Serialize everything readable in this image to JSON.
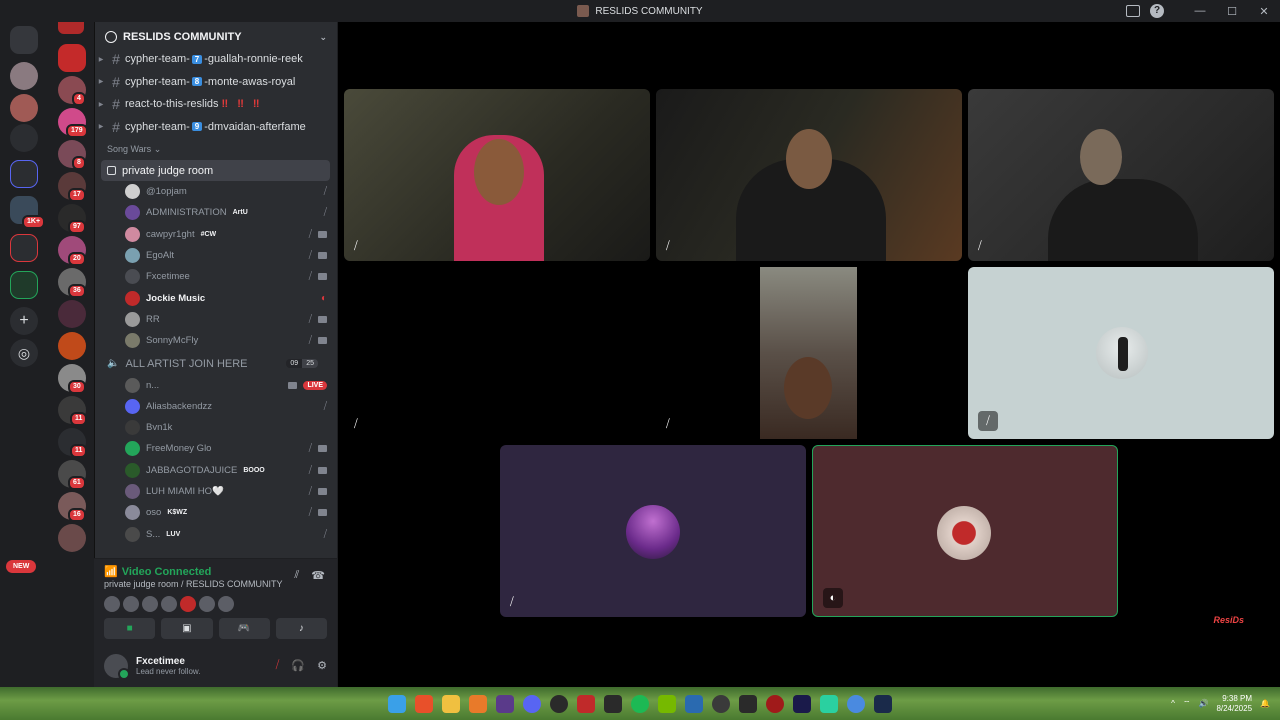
{
  "window": {
    "title": "RESLIDS COMMUNITY"
  },
  "server": {
    "name": "RESLIDS COMMUNITY"
  },
  "rail_badges": [
    "4",
    "179",
    "8",
    "17",
    "1K+",
    "97",
    "20",
    "36",
    "30",
    "11",
    "11",
    "61",
    "16"
  ],
  "new_label": "NEW",
  "text_channels": [
    {
      "prefix": "cypher-team-",
      "num": "7",
      "suffix": "-guallah-ronnie-reek"
    },
    {
      "prefix": "cypher-team-",
      "num": "8",
      "suffix": "-monte-awas-royal"
    },
    {
      "prefix": "react-to-this-reslids",
      "num": "",
      "suffix": "‼ ‼ ‼"
    },
    {
      "prefix": "cypher-team-",
      "num": "9",
      "suffix": "-dmvaidan-afterfame"
    }
  ],
  "category": "Song Wars",
  "voice_channel_1": {
    "name": "private judge room",
    "members": [
      {
        "name": "@1opjam",
        "tag": ""
      },
      {
        "name": "ADMINISTRATION",
        "tag": "ArtU"
      },
      {
        "name": "cawpyr1ght",
        "tag": "#CW"
      },
      {
        "name": "EgoAlt",
        "tag": ""
      },
      {
        "name": "Fxcetimee",
        "tag": ""
      },
      {
        "name": "Jockie Music",
        "tag": ""
      },
      {
        "name": "RR",
        "tag": ""
      },
      {
        "name": "SonnyMcFly",
        "tag": ""
      }
    ]
  },
  "voice_channel_2": {
    "name": "ALL ARTIST JOIN HERE",
    "count_a": "09",
    "count_b": "25",
    "members": [
      {
        "name": "n...",
        "tag": "",
        "live": "LIVE"
      },
      {
        "name": "Aliasbackendzz",
        "tag": ""
      },
      {
        "name": "Bvn1k",
        "tag": ""
      },
      {
        "name": "FreeMoney Glo",
        "tag": ""
      },
      {
        "name": "JABBAGOTDAJUICE",
        "tag": "BOOO"
      },
      {
        "name": "LUH MIAMI HO🤍",
        "tag": ""
      },
      {
        "name": "oso",
        "tag": "K$WZ"
      },
      {
        "name": "S...",
        "tag": "LUV"
      }
    ]
  },
  "voice_panel": {
    "status": "Video Connected",
    "location": "private judge room / RESLIDS COMMUNITY"
  },
  "user": {
    "name": "Fxcetimee",
    "status": "Lead never follow."
  },
  "clock": {
    "time": "9:38 PM",
    "date": "8/24/2025"
  },
  "colors": {
    "accent_green": "#23a55a",
    "danger": "#da373c",
    "sidebar": "#2b2d31",
    "tile_purple": "#2f2640",
    "tile_maroon": "#4e2a2e"
  }
}
